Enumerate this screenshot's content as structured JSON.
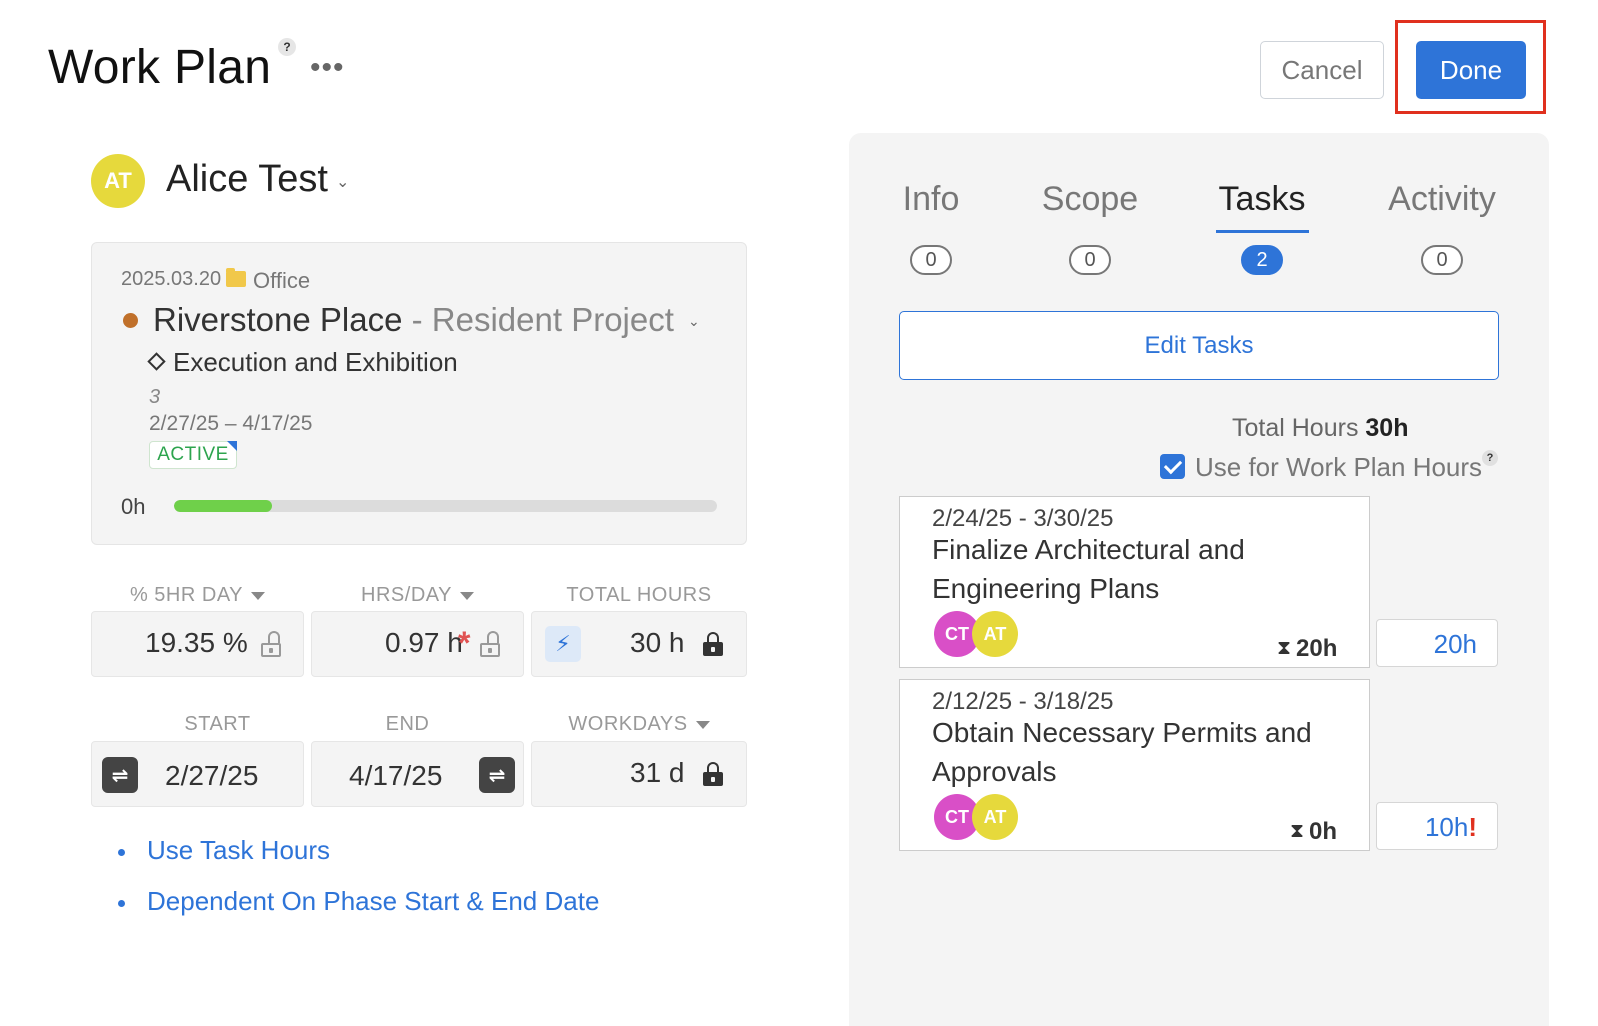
{
  "header": {
    "title": "Work Plan",
    "help": "?",
    "more": "•••",
    "cancel_label": "Cancel",
    "done_label": "Done"
  },
  "person": {
    "initials": "AT",
    "name": "Alice Test",
    "chevron": "⌄"
  },
  "phase": {
    "date": "2025.03.20",
    "folder": "Office",
    "project_name": "Riverstone Place",
    "project_sub": " - Resident Project",
    "chevron": "⌄",
    "phase_name": "Execution and Exhibition",
    "phase_number": "3",
    "date_range": "2/27/25 – 4/17/25",
    "status": "ACTIVE",
    "hours_label": "0h",
    "progress_fraction": 0.18,
    "project_color": "#c0702a",
    "status_color": "#2da44e"
  },
  "metrics": {
    "row1": [
      {
        "label": "% 5HR DAY",
        "value": "19.35 %"
      },
      {
        "label": "HRS/DAY",
        "value": "0.97 h",
        "required_mark": "*"
      },
      {
        "label": "TOTAL HOURS",
        "value": "30 h",
        "icon": "lightning-icon"
      }
    ],
    "row2": [
      {
        "label": "START",
        "value": "2/27/25",
        "icon": "dependency-icon"
      },
      {
        "label": "END",
        "value": "4/17/25",
        "icon": "dependency-icon"
      },
      {
        "label": "WORKDAYS",
        "value": "31 d"
      }
    ]
  },
  "links": [
    "Use Task Hours",
    "Dependent On Phase Start & End Date"
  ],
  "tabs": [
    {
      "label": "Info",
      "count": "0"
    },
    {
      "label": "Scope",
      "count": "0"
    },
    {
      "label": "Tasks",
      "count": "2",
      "active": true
    },
    {
      "label": "Activity",
      "count": "0"
    }
  ],
  "tasks_panel": {
    "edit_label": "Edit Tasks",
    "total_label": "Total Hours",
    "total_value": "30h",
    "use_label": "Use for Work Plan Hours",
    "use_checked": true,
    "help": "?"
  },
  "tasks": [
    {
      "dates": "2/24/25 - 3/30/25",
      "title_line1": "Finalize Architectural and",
      "title_line2": "Engineering Plans",
      "assignees": [
        "CT",
        "AT"
      ],
      "estimated": "20h",
      "hours": "20h",
      "warning": ""
    },
    {
      "dates": "2/12/25 - 3/18/25",
      "title_line1": "Obtain Necessary Permits and",
      "title_line2": "Approvals",
      "assignees": [
        "CT",
        "AT"
      ],
      "estimated": "0h",
      "hours": "10h",
      "warning": "!"
    }
  ],
  "colors": {
    "accent": "#2e74d8",
    "highlight_outline": "#e0301e",
    "progress": "#6fd04a",
    "avatar_ct": "#d94fc7",
    "avatar_at": "#e6d93c"
  }
}
